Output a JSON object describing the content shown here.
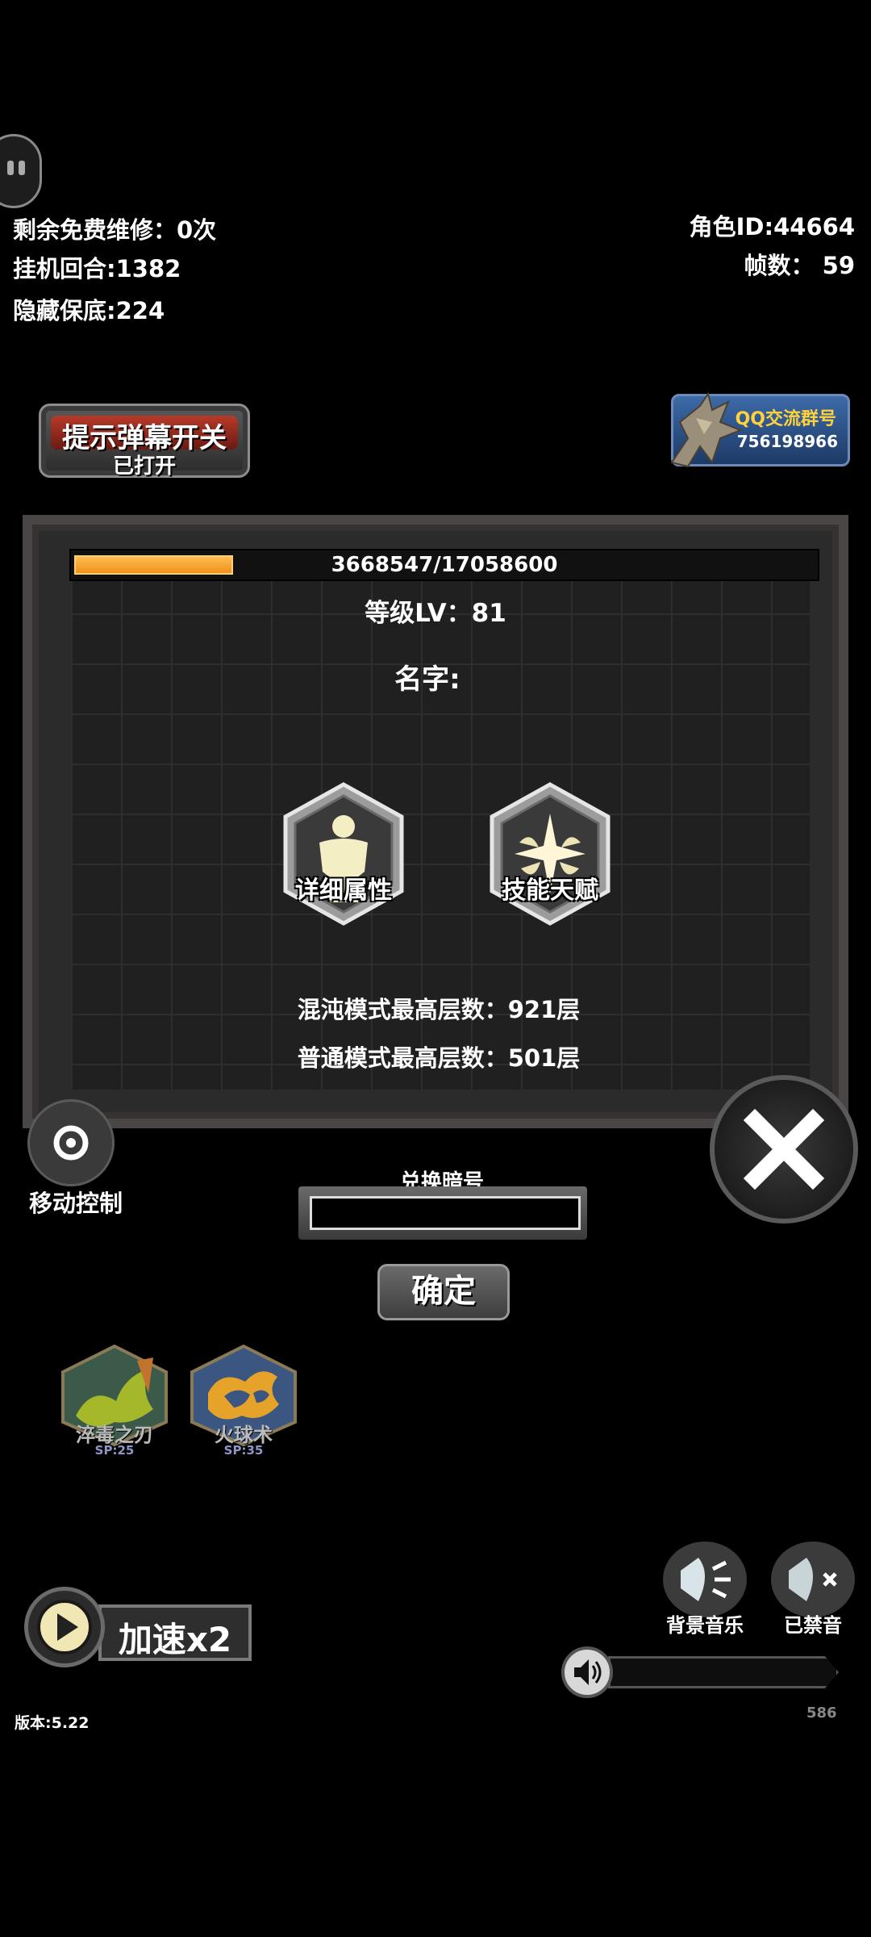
{
  "stats": {
    "free_repairs": "剩余免费维修：0次",
    "idle_rounds": "挂机回合:1382",
    "hidden_pity": "隐藏保底:224",
    "role_id": "角色ID:44664",
    "fps": "帧数：  59"
  },
  "danmaku": {
    "title": "提示弹幕开关",
    "status": "已打开"
  },
  "qq_banner": {
    "title": "QQ交流群号",
    "number": "756198966"
  },
  "experience": {
    "text": "3668547/17058600",
    "current": 3668547,
    "max": 17058600
  },
  "level": "等级LV：81",
  "name_label": "名字:",
  "buttons": {
    "details": "详细属性",
    "skills": "技能天赋"
  },
  "records": {
    "chaos": "混沌模式最高层数：921层",
    "normal": "普通模式最高层数：501层"
  },
  "move_control": "移动控制",
  "redeem": {
    "label": "兑换暗号",
    "value": "",
    "confirm": "确定"
  },
  "skills": [
    {
      "name": "淬毒之刃",
      "sp": "SP:25"
    },
    {
      "name": "火球术",
      "sp": "SP:35"
    }
  ],
  "speed": "加速x2",
  "sound": {
    "bgm": "背景音乐",
    "mute": "已禁音"
  },
  "version": "版本:5.22",
  "volume_value": "586",
  "icons": [
    "chat-icon",
    "target-icon",
    "close-icon",
    "play-icon",
    "speaker-icon",
    "body-icon",
    "star-wings-icon"
  ]
}
